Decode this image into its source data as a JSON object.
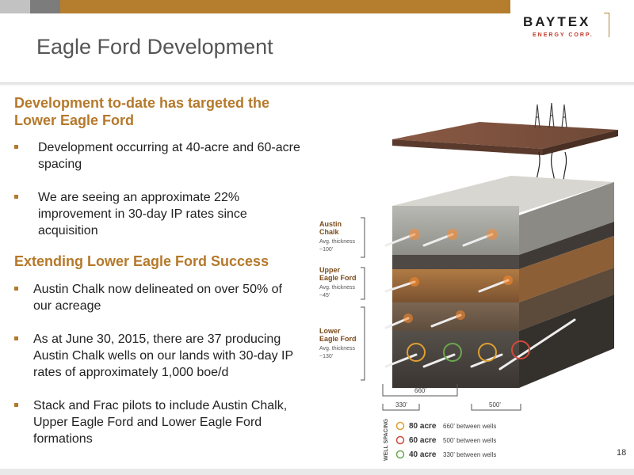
{
  "header": {
    "logo_name": "BAYTEX",
    "logo_sub": "ENERGY CORP.",
    "colors": {
      "bar_light": "#c2c2c2",
      "bar_dark": "#7c7c7c",
      "bar_accent": "#b47e2e",
      "heading": "#b5792b"
    }
  },
  "title": "Eagle Ford Development",
  "section1": {
    "heading": "Development to-date has targeted the Lower Eagle Ford",
    "bullets": [
      "Development occurring at 40-acre and 60-acre spacing",
      "We are seeing an approximate 22% improvement in 30-day IP rates since acquisition"
    ]
  },
  "section2": {
    "heading": "Extending Lower Eagle Ford Success",
    "bullets": [
      "Austin Chalk now delineated on over 50% of our acreage",
      "As at June 30, 2015, there are 37 producing Austin Chalk wells on our lands with 30-day IP rates of approximately 1,000 boe/d",
      "Stack and Frac pilots to include Austin Chalk, Upper Eagle Ford and Lower Eagle Ford formations"
    ]
  },
  "diagram": {
    "layers": [
      {
        "name": "Austin Chalk",
        "thickness_label": "Avg. thickness",
        "thickness": "~100'"
      },
      {
        "name": "Upper Eagle Ford",
        "thickness_label": "Avg. thickness",
        "thickness": "~45'"
      },
      {
        "name": "Lower Eagle Ford",
        "thickness_label": "Avg. thickness",
        "thickness": "~130'"
      }
    ],
    "dimensions": {
      "d660": "660'",
      "d330": "330'",
      "d500": "500'"
    },
    "spacing_title": "WELL SPACING",
    "spacing": [
      {
        "acre": "80 acre",
        "desc": "660' between wells",
        "color": "#e0a030"
      },
      {
        "acre": "60 acre",
        "desc": "500' between wells",
        "color": "#d24a3a"
      },
      {
        "acre": "40 acre",
        "desc": "330' between wells",
        "color": "#6aa84f"
      }
    ]
  },
  "page_number": "18"
}
